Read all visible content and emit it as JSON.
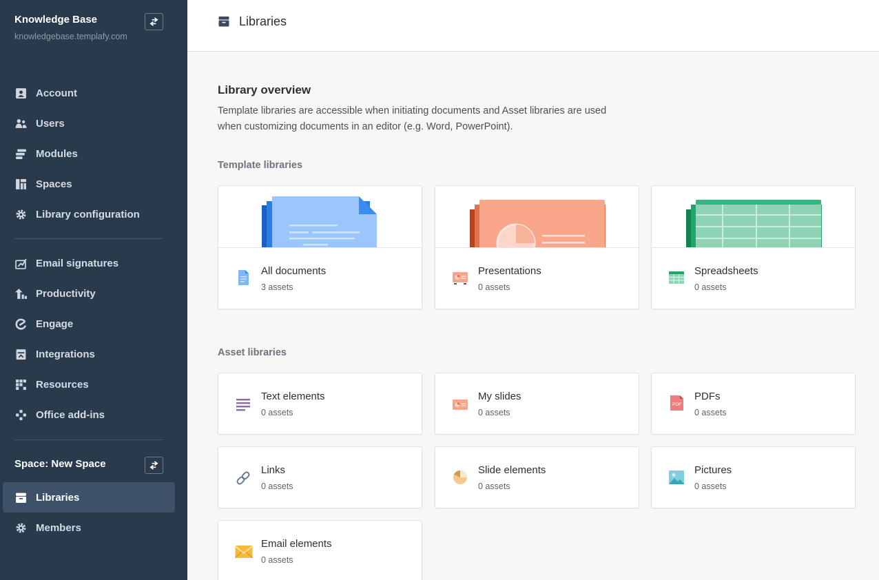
{
  "sidebar": {
    "org_name": "Knowledge Base",
    "org_url": "knowledgebase.templafy.com",
    "items": [
      {
        "label": "Account",
        "icon": "account-icon"
      },
      {
        "label": "Users",
        "icon": "users-icon"
      },
      {
        "label": "Modules",
        "icon": "modules-icon"
      },
      {
        "label": "Spaces",
        "icon": "spaces-icon"
      },
      {
        "label": "Library configuration",
        "icon": "gear-icon"
      },
      {
        "label": "Email signatures",
        "icon": "signature-icon"
      },
      {
        "label": "Productivity",
        "icon": "productivity-icon"
      },
      {
        "label": "Engage",
        "icon": "engage-icon"
      },
      {
        "label": "Integrations",
        "icon": "integrations-icon"
      },
      {
        "label": "Resources",
        "icon": "resources-icon"
      },
      {
        "label": "Office add-ins",
        "icon": "add-ins-icon"
      }
    ],
    "space_label": "Space: New Space",
    "space_items": [
      {
        "label": "Libraries",
        "icon": "libraries-icon",
        "active": true
      },
      {
        "label": "Members",
        "icon": "gear-icon"
      }
    ]
  },
  "header": {
    "title": "Libraries"
  },
  "overview": {
    "heading": "Library overview",
    "description": "Template libraries are accessible when initiating documents and Asset libraries are used when customizing documents in an editor (e.g. Word, PowerPoint)."
  },
  "template_libraries": {
    "label": "Template libraries",
    "cards": [
      {
        "title": "All documents",
        "count": "3 assets",
        "icon": "document-icon"
      },
      {
        "title": "Presentations",
        "count": "0 assets",
        "icon": "presentation-icon"
      },
      {
        "title": "Spreadsheets",
        "count": "0 assets",
        "icon": "spreadsheet-icon"
      }
    ]
  },
  "asset_libraries": {
    "label": "Asset libraries",
    "cards": [
      {
        "title": "Text elements",
        "count": "0 assets",
        "icon": "text-elements-icon"
      },
      {
        "title": "My slides",
        "count": "0 assets",
        "icon": "slides-icon"
      },
      {
        "title": "PDFs",
        "count": "0 assets",
        "icon": "pdf-icon",
        "icon_text": "PDF"
      },
      {
        "title": "Links",
        "count": "0 assets",
        "icon": "link-icon"
      },
      {
        "title": "Slide elements",
        "count": "0 assets",
        "icon": "pie-chart-icon"
      },
      {
        "title": "Pictures",
        "count": "0 assets",
        "icon": "picture-icon"
      },
      {
        "title": "Email elements",
        "count": "0 assets",
        "icon": "envelope-icon"
      }
    ]
  },
  "colors": {
    "sidebar_bg": "#2a3a4d",
    "sidebar_active": "#3d5168",
    "doc_blue": "#7fb6f5",
    "presentation_orange": "#f7a58a",
    "spreadsheet_green": "#8fd3b6"
  }
}
